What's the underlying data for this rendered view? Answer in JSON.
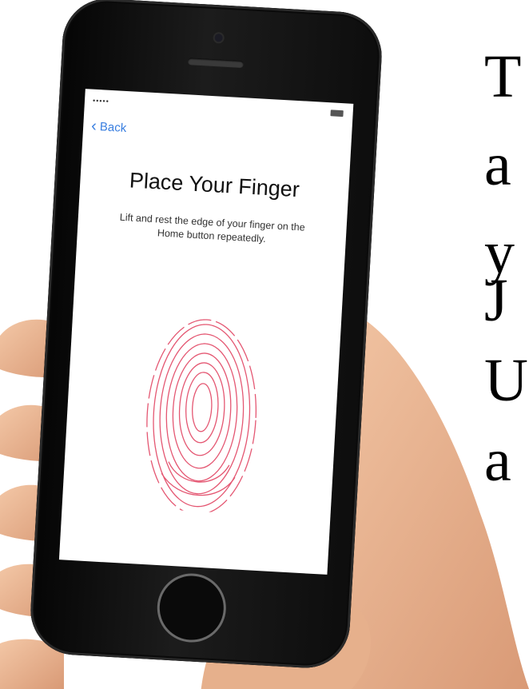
{
  "status_bar": {
    "signal": "•••••",
    "battery_icon": "battery-icon"
  },
  "nav": {
    "back_label": "Back",
    "back_icon": "chevron-left-icon"
  },
  "screen": {
    "title": "Place Your Finger",
    "subtitle": "Lift and rest the edge of your finger on the Home button repeatedly."
  },
  "fingerprint_color": "#e03a5a",
  "accent": "#3a7fe0",
  "side_text": [
    "T",
    "a",
    "y",
    "J",
    "U",
    "a"
  ]
}
